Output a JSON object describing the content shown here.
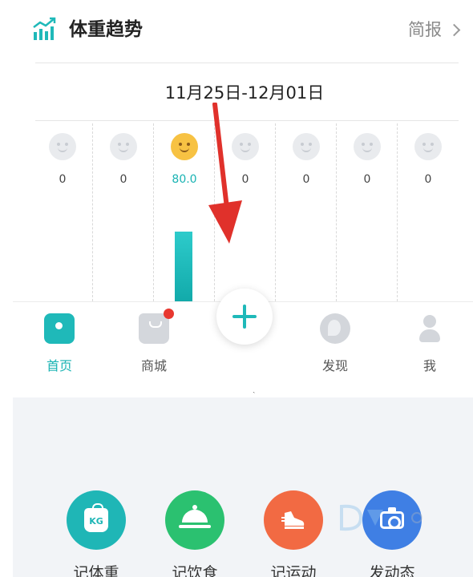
{
  "header": {
    "title": "体重趋势",
    "brief_label": "简报",
    "trend_icon": "chart-trend-icon"
  },
  "week": {
    "date_range": "11月25日-12月01日",
    "days": [
      {
        "value": "0",
        "active": false,
        "bar_fraction": 0
      },
      {
        "value": "0",
        "active": false,
        "bar_fraction": 0
      },
      {
        "value": "80.0",
        "active": true,
        "bar_fraction": 0.4
      },
      {
        "value": "0",
        "active": false,
        "bar_fraction": 0
      },
      {
        "value": "0",
        "active": false,
        "bar_fraction": 0
      },
      {
        "value": "0",
        "active": false,
        "bar_fraction": 0
      },
      {
        "value": "0",
        "active": false,
        "bar_fraction": 0
      }
    ]
  },
  "tabbar": {
    "home": "首页",
    "shop": "商城",
    "discover": "发现",
    "me": "我",
    "shop_has_badge": true
  },
  "actions": {
    "weight": "记体重",
    "weight_unit": "KG",
    "food": "记饮食",
    "sport": "记运动",
    "post": "发动态"
  },
  "colors": {
    "accent": "#1fb9b9",
    "food": "#2bc170",
    "sport": "#f26a43",
    "post": "#3f7fe4",
    "badge": "#e8382f",
    "annotation_arrow": "#e0312b"
  }
}
